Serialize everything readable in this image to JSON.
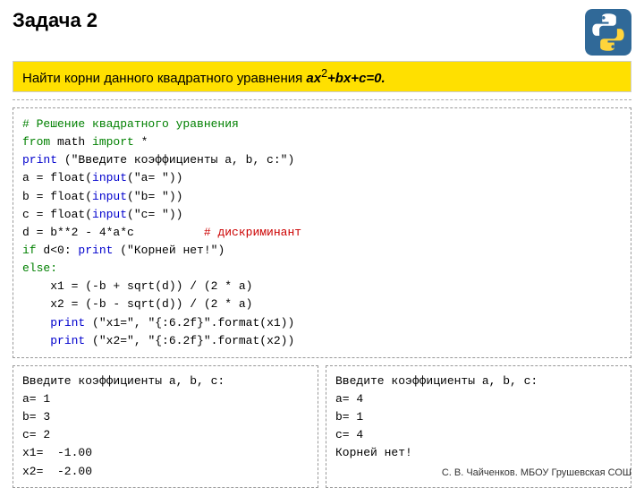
{
  "header": {
    "title": "Задача 2",
    "task_label": "Найти корни данного квадратного уравнения",
    "task_formula": "ax²+bx+c=0."
  },
  "python_logo": {
    "alt": "Python logo"
  },
  "code": {
    "lines": [
      {
        "text": "# Решение квадратного уравнения",
        "color": "green"
      },
      {
        "text": "from math import *",
        "color": "mixed_from"
      },
      {
        "text": "print (\"Введите коэффициенты a, b, c:\")",
        "color": "mixed_print"
      },
      {
        "text": "a = float(input(\"a= \"))",
        "color": "mixed"
      },
      {
        "text": "b = float(input(\"b= \"))",
        "color": "mixed"
      },
      {
        "text": "c = float(input(\"c= \"))",
        "color": "mixed"
      },
      {
        "text": "d = b**2 - 4*a*c          # дискриминант",
        "color": "mixed_comment"
      },
      {
        "text": "if d<0: print (\"Корней нет!\")",
        "color": "mixed_if"
      },
      {
        "text": "else:",
        "color": "blue"
      },
      {
        "text": "    x1 = (-b + sqrt(d)) / (2 * a)",
        "color": "black_indent"
      },
      {
        "text": "    x2 = (-b - sqrt(d)) / (2 * a)",
        "color": "black_indent"
      },
      {
        "text": "    print (\"x1=\", \"{:6.2f}\".format(x1))",
        "color": "print_indent"
      },
      {
        "text": "    print (\"x2=\", \"{:6.2f}\".format(x2))",
        "color": "print_indent"
      }
    ]
  },
  "output1": {
    "lines": [
      "Введите коэффициенты a, b, c:",
      "a= 1",
      "b= 3",
      "c= 2",
      "x1=  -1.00",
      "x2=  -2.00"
    ]
  },
  "output2": {
    "lines": [
      "Введите коэффициенты a, b, c:",
      "a= 4",
      "b= 1",
      "c= 4",
      "Корней нет!"
    ]
  },
  "footer": {
    "text": "С. В. Чайченков. МБОУ Грушевская СОШ"
  }
}
